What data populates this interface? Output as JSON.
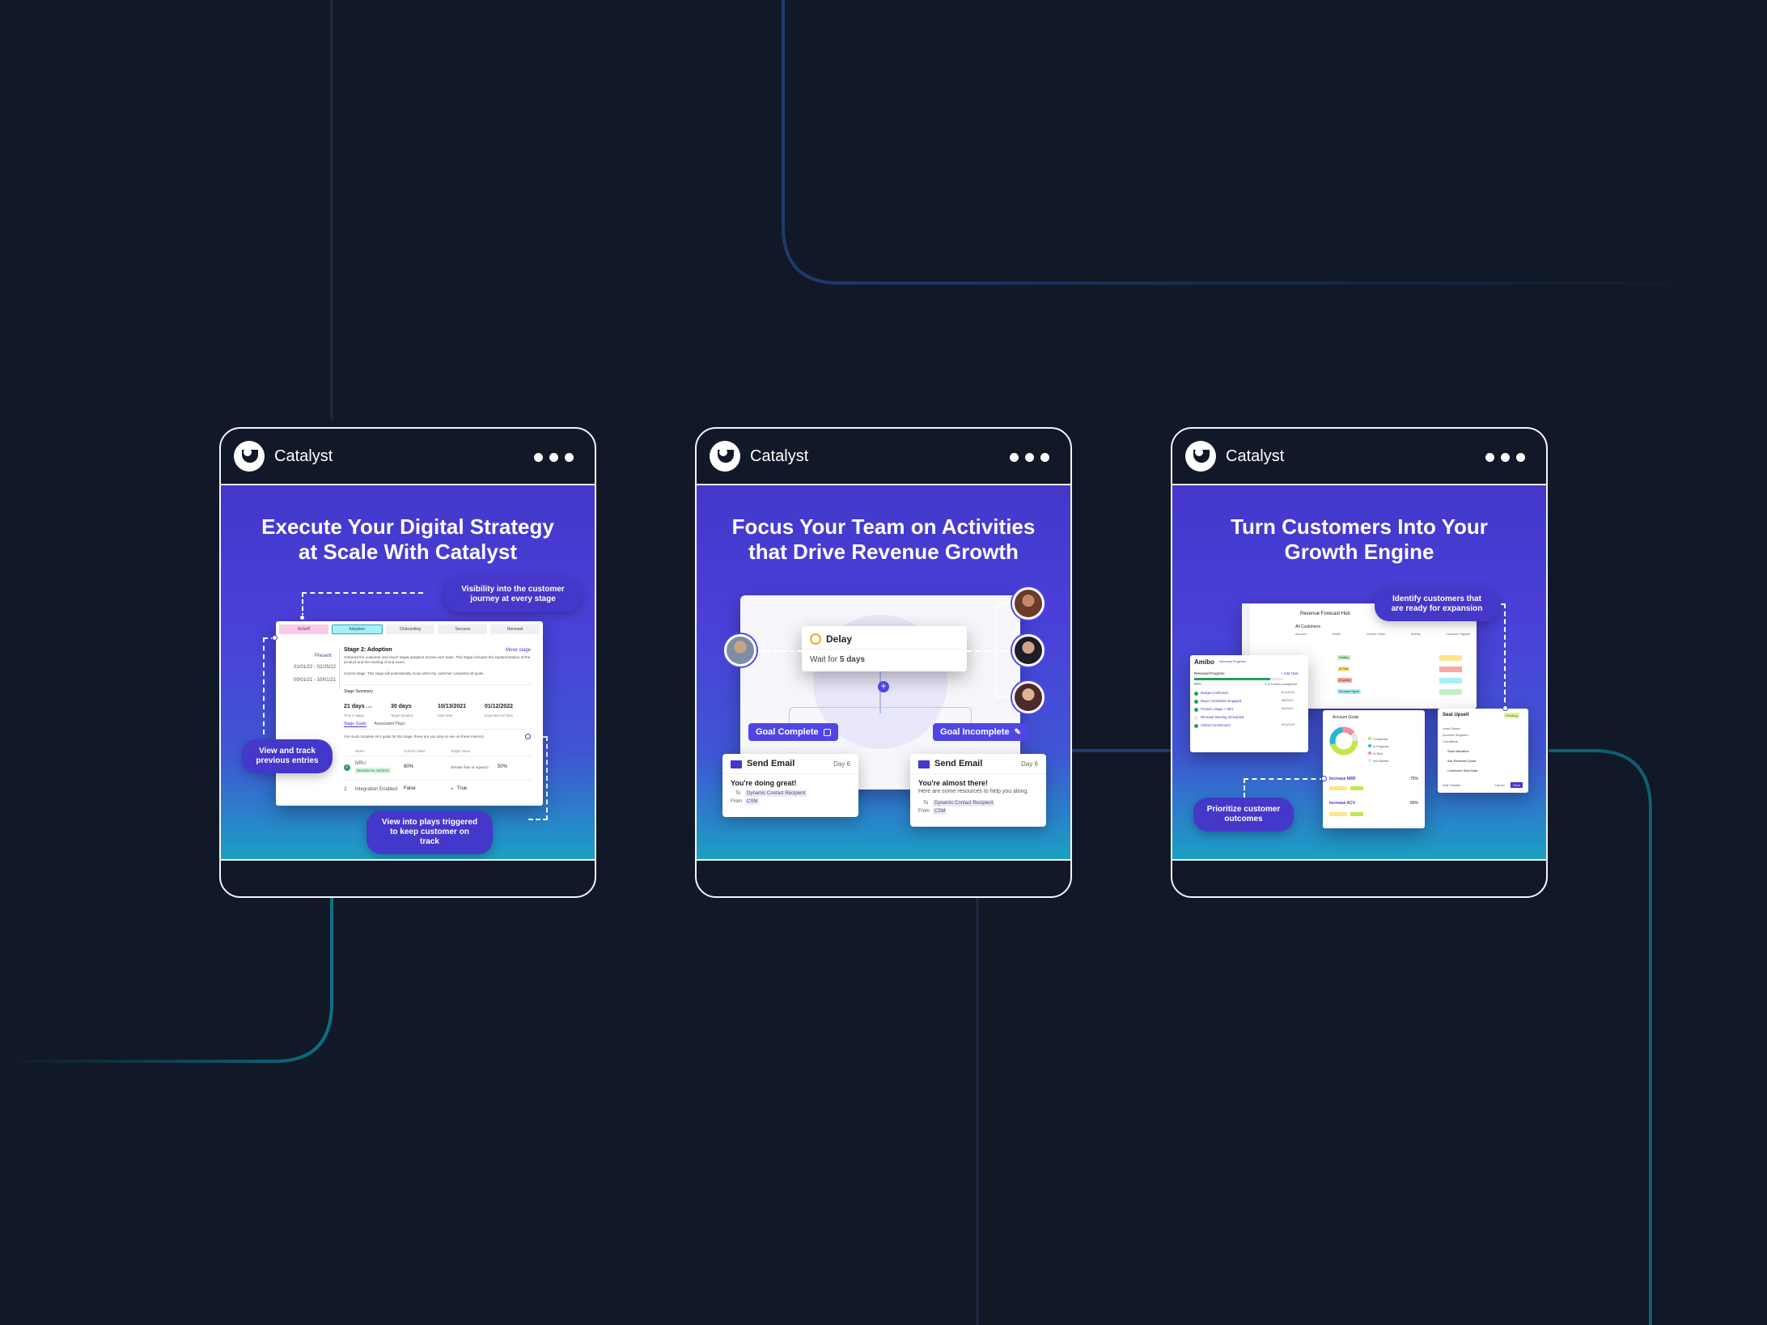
{
  "cards": [
    {
      "brand": "Catalyst",
      "title": "Execute Your Digital Strategy at Scale With Catalyst",
      "callouts": {
        "visibility": "Visibility into the customer journey at every stage",
        "view_track": "View and track previous entries",
        "plays": "View into plays triggered to keep customer on track"
      },
      "stages": [
        "Kickoff",
        "Adoption",
        "Onboarding",
        "Success",
        "Renewal"
      ],
      "stage_title": "Stage 2: Adoption",
      "stage_desc": "Onboard the customer and reach target adoption across user base. This stage includes the implementation of the product and the training of end users.",
      "current_stage_note": "Current stage. This stage will automatically move when the customer completes all goals.",
      "move_stage": "Move stage",
      "present": "Present",
      "date_range_1": "01/01/22 - 02/25/22",
      "date_range_2": "09/01/21 - 10/01/21",
      "stage_summary": "Stage Summary",
      "metrics": [
        {
          "v": "21 days",
          "s": "Time in stage",
          "flag": "Late"
        },
        {
          "v": "30 days",
          "s": "Target duration"
        },
        {
          "v": "10/13/2021",
          "s": "Start date"
        },
        {
          "v": "01/12/2022",
          "s": "Expected end date"
        }
      ],
      "tabs": [
        "Stage Goals",
        "Associated Plays"
      ],
      "goal_note": "You must complete all 4 goals for this stage; these are you step-on see on these metrics)",
      "cols": [
        "Name",
        "Current Value",
        "Target Value"
      ],
      "rows": [
        {
          "n": "NRU",
          "tag": "Reached on 10/15/21",
          "c": "80%",
          "t": "Greater than or equal to",
          "v": "50%"
        },
        {
          "n": "Integration Enabled",
          "c": "False",
          "t": "=",
          "v": "True"
        }
      ]
    },
    {
      "brand": "Catalyst",
      "title": "Focus Your Team on Activities that Drive Revenue Growth",
      "delay": {
        "title": "Delay",
        "wait_prefix": "Wait for ",
        "wait_value": "5 days"
      },
      "goal_complete": "Goal Complete",
      "goal_incomplete": "Goal Incomplete",
      "emails": [
        {
          "title": "Send Email",
          "day": "Day 6",
          "subject": "You're doing great!",
          "to_label": "To",
          "to": "Dynamic Contact Recipient",
          "from_label": "From",
          "from": "CSM"
        },
        {
          "title": "Send Email",
          "day": "Day 6",
          "subject": "You're almost there!",
          "body": "Here are some resources to help you along.",
          "to_label": "To",
          "to": "Dynamic Contact Recipient",
          "from_label": "From",
          "from": "CSM"
        }
      ]
    },
    {
      "brand": "Catalyst",
      "title": "Turn Customers Into Your Growth Engine",
      "callouts": {
        "identify": "Identify customers that are ready for expansion",
        "prioritize": "Prioritize customer outcomes"
      },
      "hub": {
        "title": "Revenue Forecast Hub",
        "subtitle": "All Customers",
        "cols": [
          "Account",
          "Health",
          "Current Value",
          "Activity",
          "Customer Signals"
        ],
        "tags": [
          "Healthy",
          "At Risk",
          "Churned",
          "Renewal Signal"
        ]
      },
      "amibo": {
        "name": "Amibo",
        "badge": "Renewal Progress",
        "pct": "85%",
        "progress": 0.85,
        "section": "Renewal Progress",
        "add": "+ Add Task",
        "count": "4 of 5 tasks completed",
        "items": [
          "Budget Confirmed",
          "Buyer Committee Engaged",
          "Product Usage > 85%",
          "Renewal Meeting Scheduled",
          "Verbal Commitment"
        ],
        "dates": [
          "8/11/2021",
          "8/8/2021",
          "8/3/2021",
          "",
          "8/20/2021"
        ]
      },
      "goals": {
        "title": "Account Goals",
        "g1": "Increase NRR",
        "g1v": "75%",
        "g2": "Increase ACV",
        "g2v": "80%",
        "legend": [
          "Completed",
          "In Progress",
          "At Risk",
          "Not Started"
        ]
      },
      "upsell": {
        "title": "Seat Upsell",
        "badge": "Pending",
        "rows": [
          "Lead Owner",
          "Account Segment",
          "Conditions"
        ],
        "items": [
          "Seat Utilization",
          "Ask Renewal Quote",
          "Confirmed Start Date"
        ],
        "link": "Add Contact",
        "buttons": [
          "Cancel",
          "Save"
        ]
      }
    }
  ]
}
